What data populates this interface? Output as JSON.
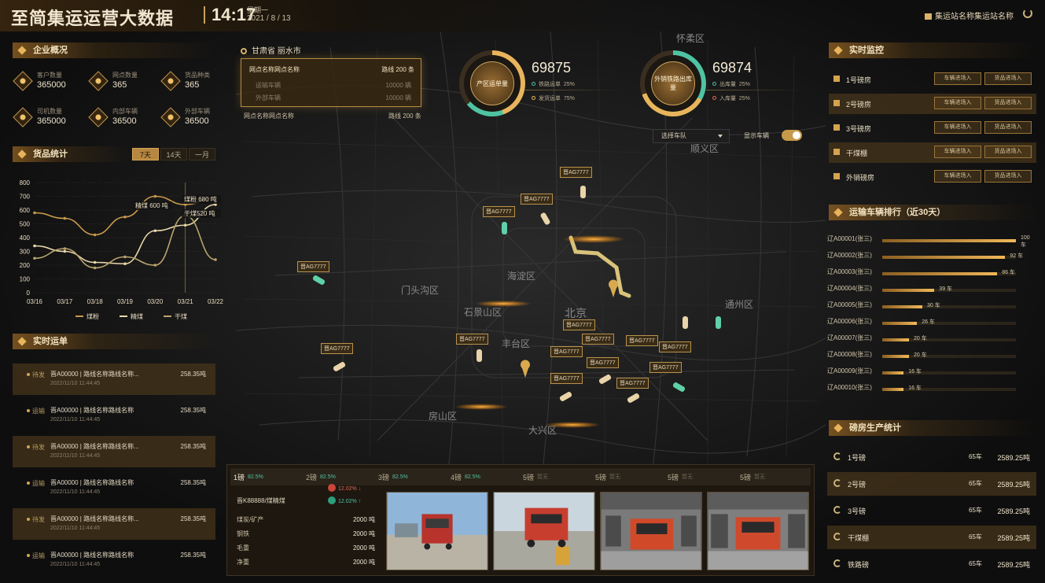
{
  "header": {
    "title": "至简集运运营大数据",
    "time": "14:17",
    "weekday": "星期一",
    "date": "2021 / 8 / 13",
    "station": "集运站名称集运站名称"
  },
  "overview": {
    "title": "企业概况",
    "items": [
      {
        "label": "客户数量",
        "value": "365000"
      },
      {
        "label": "网点数量",
        "value": "365"
      },
      {
        "label": "货品种类",
        "value": "365"
      },
      {
        "label": "司机数量",
        "value": "365000"
      },
      {
        "label": "内部车辆",
        "value": "36500"
      },
      {
        "label": "外部车辆",
        "value": "36500"
      }
    ]
  },
  "goods_stats": {
    "title": "货品统计",
    "tabs": [
      "7天",
      "14天",
      "一月"
    ],
    "active_tab": "7天"
  },
  "chart_data": {
    "type": "line",
    "categories": [
      "03/16",
      "03/17",
      "03/18",
      "03/19",
      "03/20",
      "03/21",
      "03/22"
    ],
    "series": [
      {
        "name": "煤粉",
        "color": "#c89a4a",
        "values": [
          580,
          540,
          420,
          550,
          700,
          640,
          690
        ]
      },
      {
        "name": "精煤",
        "color": "#e8d6a8",
        "values": [
          340,
          300,
          220,
          210,
          450,
          490,
          640
        ]
      },
      {
        "name": "干煤",
        "color": "#b9a46e",
        "values": [
          250,
          320,
          180,
          260,
          200,
          560,
          240
        ]
      }
    ],
    "ylim": [
      0,
      800
    ],
    "yticks": [
      0,
      100,
      200,
      300,
      400,
      500,
      600,
      700,
      800
    ],
    "annotations": [
      "精煤 600 吨",
      "煤粉 680 吨",
      "干煤520 吨"
    ],
    "grid": true,
    "legend": "bottom"
  },
  "waybills": {
    "title": "实时运单",
    "items": [
      {
        "status": "待发",
        "name": "晋A00000 | 路线名称路线名称...",
        "time": "2022/11/10 11:44:45",
        "weight": "258.35吨",
        "highlight": true
      },
      {
        "status": "运输",
        "name": "晋A00000 | 路线名称路线名称",
        "time": "2022/11/10 11:44:45",
        "weight": "258.35吨",
        "highlight": false
      },
      {
        "status": "待发",
        "name": "晋A00000 | 路线名称路线名称...",
        "time": "2022/11/10 11:44:45",
        "weight": "258.35吨",
        "highlight": true
      },
      {
        "status": "运输",
        "name": "晋A00000 | 路线名称路线名称",
        "time": "2022/11/10 11:44:45",
        "weight": "258.35吨",
        "highlight": false
      },
      {
        "status": "待发",
        "name": "晋A00000 | 路线名称路线名称...",
        "time": "2022/11/10 11:44:45",
        "weight": "258.35吨",
        "highlight": true
      },
      {
        "status": "运输",
        "name": "晋A00000 | 路线名称路线名称",
        "time": "2022/11/10 11:44:45",
        "weight": "258.35吨",
        "highlight": false
      }
    ]
  },
  "route": {
    "location": "甘肃省 丽水市",
    "name1": "网点名称网点名称",
    "lines1": "路线 200 条",
    "sub1_label": "运输车辆",
    "sub1_value": "10000 辆",
    "sub2_label": "外部车辆",
    "sub2_value": "10000 辆",
    "name2": "网点名称网点名称",
    "lines2": "路线 200 条"
  },
  "production": {
    "circle_label": "产区运单量",
    "value": "69875",
    "legend": [
      {
        "label": "铁路运单",
        "pct": "25%",
        "color": "#4fc3a1"
      },
      {
        "label": "发货运单",
        "pct": "75%",
        "color": "#e8b55c"
      }
    ]
  },
  "external": {
    "circle_label": "外销铁路出库量",
    "value": "69874",
    "legend": [
      {
        "label": "出库量",
        "pct": "25%",
        "color": "#4fc3a1"
      },
      {
        "label": "入库量",
        "pct": "25%",
        "color": "#e06a5a"
      }
    ]
  },
  "map_controls": {
    "fleet_select": "选择车队",
    "show_label": "显示车辆"
  },
  "map": {
    "districts": [
      "怀柔区",
      "海淀区",
      "门头沟区",
      "石景山区",
      "北京",
      "丰台区",
      "房山区",
      "大兴区",
      "顺义区",
      "通州区"
    ],
    "tag": "晋AG7777"
  },
  "bottom": {
    "tabs": [
      {
        "label": "1磅",
        "pct": "82.5%"
      },
      {
        "label": "2磅",
        "pct": "82.5%"
      },
      {
        "label": "3磅",
        "pct": "82.5%"
      },
      {
        "label": "4磅",
        "pct": "82.5%"
      },
      {
        "label": "5磅",
        "pct": "暂无"
      },
      {
        "label": "5磅",
        "pct": "暂无"
      },
      {
        "label": "5磅",
        "pct": "暂无"
      },
      {
        "label": "5磅",
        "pct": "暂无"
      }
    ],
    "truck": "晋K88888/煤精煤",
    "badge_up": "12.02% ↓",
    "badge_down": "12.02% ↑",
    "rows": [
      {
        "label": "煤炭/矿产",
        "value": "2000 吨"
      },
      {
        "label": "钢铁",
        "value": "2000 吨"
      },
      {
        "label": "毛重",
        "value": "2000 吨"
      },
      {
        "label": "净重",
        "value": "2000 吨"
      }
    ]
  },
  "monitor": {
    "title": "实时监控",
    "btn1": "车辆进场入",
    "btn2": "货品进场入",
    "items": [
      "1号磅房",
      "2号磅房",
      "3号磅房",
      "干煤棚",
      "外销磅房"
    ]
  },
  "ranking": {
    "title": "运输车辆排行（近30天）",
    "items": [
      {
        "name": "辽A00001(张三)",
        "value": 100,
        "label": "100 车"
      },
      {
        "name": "辽A00002(张三)",
        "value": 92,
        "label": "92 车"
      },
      {
        "name": "辽A00003(张三)",
        "value": 86,
        "label": "86 车"
      },
      {
        "name": "辽A00004(张三)",
        "value": 39,
        "label": "39 车"
      },
      {
        "name": "辽A00005(张三)",
        "value": 30,
        "label": "30 车"
      },
      {
        "name": "辽A00006(张三)",
        "value": 26,
        "label": "26 车"
      },
      {
        "name": "辽A00007(张三)",
        "value": 20,
        "label": "20 车"
      },
      {
        "name": "辽A00008(张三)",
        "value": 20,
        "label": "20 车"
      },
      {
        "name": "辽A00009(张三)",
        "value": 16,
        "label": "16 车"
      },
      {
        "name": "辽A00010(张三)",
        "value": 16,
        "label": "16 车"
      }
    ]
  },
  "weigh_production": {
    "title": "磅房生产统计",
    "items": [
      {
        "name": "1号磅",
        "count": "65车",
        "weight": "2589.25吨"
      },
      {
        "name": "2号磅",
        "count": "65车",
        "weight": "2589.25吨"
      },
      {
        "name": "3号磅",
        "count": "65车",
        "weight": "2589.25吨"
      },
      {
        "name": "干煤棚",
        "count": "65车",
        "weight": "2589.25吨"
      },
      {
        "name": "铁路磅",
        "count": "65车",
        "weight": "2589.25吨"
      }
    ]
  }
}
